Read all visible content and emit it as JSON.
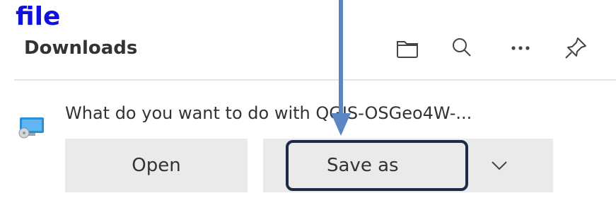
{
  "annotation": {
    "label": "file",
    "label_color": "#1111dd",
    "arrow_color": "#5b86c3",
    "highlight_color": "#1c2a47"
  },
  "panel": {
    "title": "Downloads",
    "toolbar": {
      "icons": [
        "folder-icon",
        "search-icon",
        "more-icon",
        "pin-icon"
      ]
    }
  },
  "download": {
    "file_icon": "installer-file-icon",
    "prompt": "What do you want to do with QGIS-OSGeo4W-...",
    "open_label": "Open",
    "save_as_label": "Save as",
    "options_icon": "chevron-down-icon"
  }
}
